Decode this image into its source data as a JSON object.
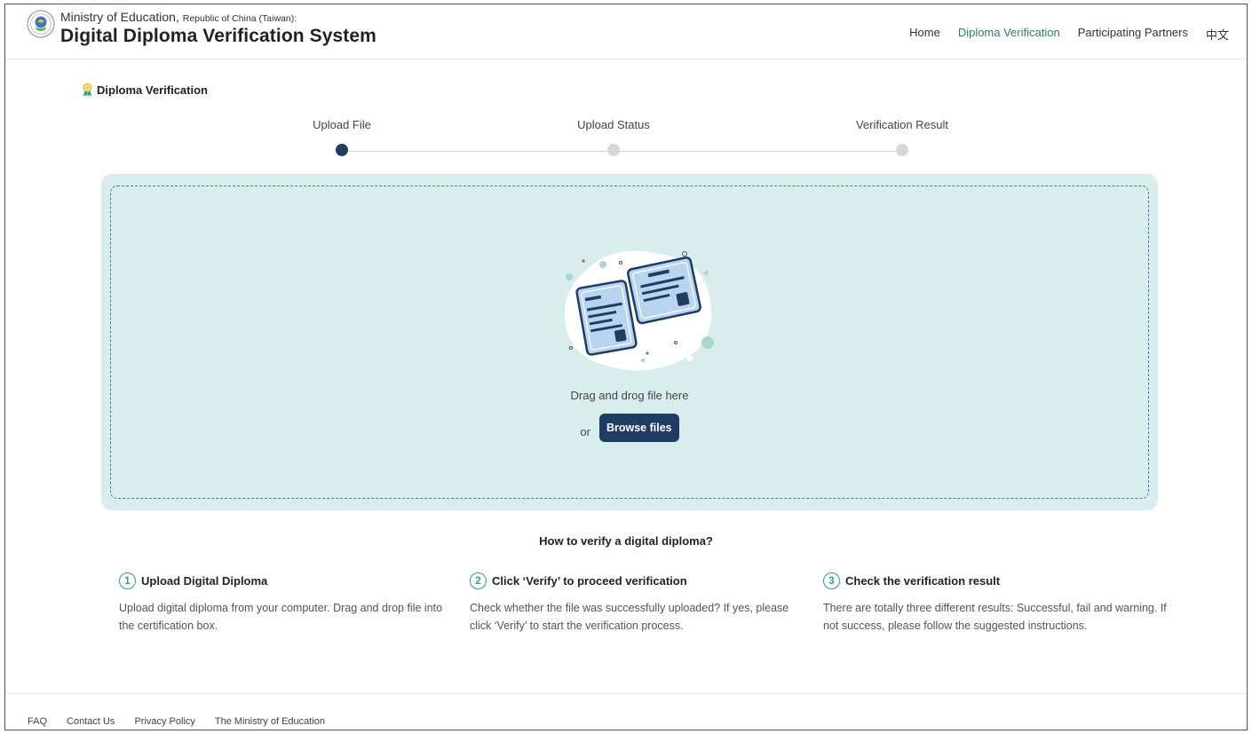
{
  "header": {
    "ministry": "Ministry of Education,",
    "ministry_suffix": "Republic of China (Taiwan):",
    "system_title": "Digital Diploma Verification System"
  },
  "nav": {
    "home": "Home",
    "diploma_verification": "Diploma Verification",
    "participating_partners": "Participating Partners",
    "language": "中文"
  },
  "section": {
    "title": "Diploma Verification"
  },
  "steps": [
    {
      "label": "Upload File",
      "active": true
    },
    {
      "label": "Upload Status",
      "active": false
    },
    {
      "label": "Verification Result",
      "active": false
    }
  ],
  "dropzone": {
    "drag_text": "Drag and drog file here",
    "or_text": "or",
    "browse_label": "Browse files"
  },
  "howto": {
    "title": "How to verify a digital diploma?",
    "items": [
      {
        "num": "1",
        "title": "Upload Digital Diploma",
        "desc": "Upload digital diploma from your computer. Drag and drop file into the certification box."
      },
      {
        "num": "2",
        "title": "Click ‘Verify’ to proceed verification",
        "desc": "Check whether the file was successfully uploaded? If yes, please click ‘Verify’ to start the verification process."
      },
      {
        "num": "3",
        "title": "Check the verification result",
        "desc": "There are totally three different results: Successful, fail and warning. If not success, please follow the suggested instructions."
      }
    ]
  },
  "footer": {
    "links": [
      "FAQ",
      "Contact Us",
      "Privacy Policy",
      "The Ministry of Education"
    ]
  },
  "colors": {
    "accent_navy": "#1f3d64",
    "accent_teal": "#2e9c8f",
    "dropzone_bg": "#daeded"
  }
}
